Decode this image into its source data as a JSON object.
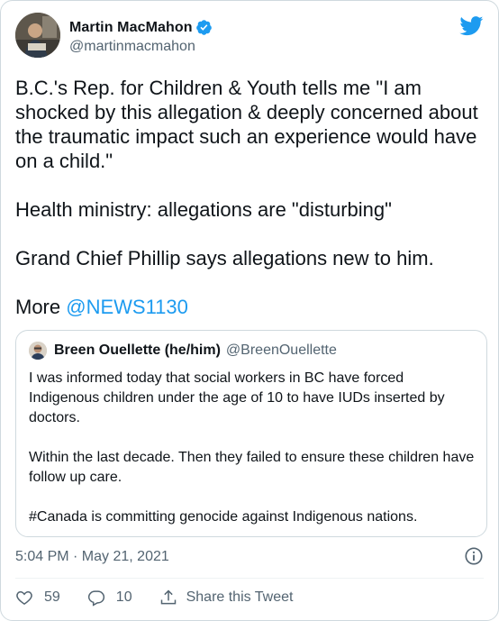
{
  "author": {
    "display_name": "Martin MacMahon",
    "handle": "@martinmacmahon",
    "verified_icon": "verified-badge-icon"
  },
  "tweet": {
    "paragraphs": [
      "B.C.'s Rep. for Children & Youth tells me \"I am shocked by this allegation & deeply concerned about the traumatic impact such an experience would have on a child.\"",
      "Health ministry: allegations are \"disturbing\"",
      "Grand Chief Phillip says allegations new to him."
    ],
    "more_prefix": "More ",
    "mention": "@NEWS1130"
  },
  "quoted_tweet": {
    "display_name": "Breen Ouellette (he/him)",
    "handle": "@BreenOuellette",
    "paragraphs": [
      "I was informed today that social workers in BC have forced Indigenous children under the age of 10 to have IUDs inserted by doctors.",
      "Within the last decade. Then they failed to ensure these children have follow up care.",
      "#Canada is committing genocide against Indigenous nations."
    ]
  },
  "meta": {
    "timestamp": "5:04 PM · May 21, 2021"
  },
  "actions": {
    "like_count": "59",
    "reply_count": "10",
    "share_label": "Share this Tweet"
  },
  "colors": {
    "brand_blue": "#1d9bf0",
    "secondary_text": "#536471",
    "border": "#cfd9de"
  }
}
